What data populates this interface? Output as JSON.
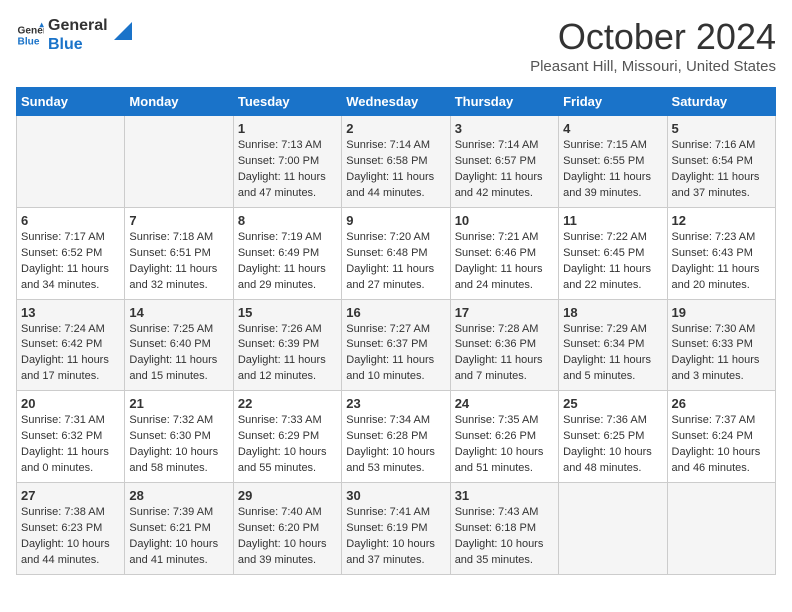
{
  "header": {
    "logo_line1": "General",
    "logo_line2": "Blue",
    "month_title": "October 2024",
    "location": "Pleasant Hill, Missouri, United States"
  },
  "days_of_week": [
    "Sunday",
    "Monday",
    "Tuesday",
    "Wednesday",
    "Thursday",
    "Friday",
    "Saturday"
  ],
  "weeks": [
    [
      {
        "day": "",
        "info": ""
      },
      {
        "day": "",
        "info": ""
      },
      {
        "day": "1",
        "info": "Sunrise: 7:13 AM\nSunset: 7:00 PM\nDaylight: 11 hours and 47 minutes."
      },
      {
        "day": "2",
        "info": "Sunrise: 7:14 AM\nSunset: 6:58 PM\nDaylight: 11 hours and 44 minutes."
      },
      {
        "day": "3",
        "info": "Sunrise: 7:14 AM\nSunset: 6:57 PM\nDaylight: 11 hours and 42 minutes."
      },
      {
        "day": "4",
        "info": "Sunrise: 7:15 AM\nSunset: 6:55 PM\nDaylight: 11 hours and 39 minutes."
      },
      {
        "day": "5",
        "info": "Sunrise: 7:16 AM\nSunset: 6:54 PM\nDaylight: 11 hours and 37 minutes."
      }
    ],
    [
      {
        "day": "6",
        "info": "Sunrise: 7:17 AM\nSunset: 6:52 PM\nDaylight: 11 hours and 34 minutes."
      },
      {
        "day": "7",
        "info": "Sunrise: 7:18 AM\nSunset: 6:51 PM\nDaylight: 11 hours and 32 minutes."
      },
      {
        "day": "8",
        "info": "Sunrise: 7:19 AM\nSunset: 6:49 PM\nDaylight: 11 hours and 29 minutes."
      },
      {
        "day": "9",
        "info": "Sunrise: 7:20 AM\nSunset: 6:48 PM\nDaylight: 11 hours and 27 minutes."
      },
      {
        "day": "10",
        "info": "Sunrise: 7:21 AM\nSunset: 6:46 PM\nDaylight: 11 hours and 24 minutes."
      },
      {
        "day": "11",
        "info": "Sunrise: 7:22 AM\nSunset: 6:45 PM\nDaylight: 11 hours and 22 minutes."
      },
      {
        "day": "12",
        "info": "Sunrise: 7:23 AM\nSunset: 6:43 PM\nDaylight: 11 hours and 20 minutes."
      }
    ],
    [
      {
        "day": "13",
        "info": "Sunrise: 7:24 AM\nSunset: 6:42 PM\nDaylight: 11 hours and 17 minutes."
      },
      {
        "day": "14",
        "info": "Sunrise: 7:25 AM\nSunset: 6:40 PM\nDaylight: 11 hours and 15 minutes."
      },
      {
        "day": "15",
        "info": "Sunrise: 7:26 AM\nSunset: 6:39 PM\nDaylight: 11 hours and 12 minutes."
      },
      {
        "day": "16",
        "info": "Sunrise: 7:27 AM\nSunset: 6:37 PM\nDaylight: 11 hours and 10 minutes."
      },
      {
        "day": "17",
        "info": "Sunrise: 7:28 AM\nSunset: 6:36 PM\nDaylight: 11 hours and 7 minutes."
      },
      {
        "day": "18",
        "info": "Sunrise: 7:29 AM\nSunset: 6:34 PM\nDaylight: 11 hours and 5 minutes."
      },
      {
        "day": "19",
        "info": "Sunrise: 7:30 AM\nSunset: 6:33 PM\nDaylight: 11 hours and 3 minutes."
      }
    ],
    [
      {
        "day": "20",
        "info": "Sunrise: 7:31 AM\nSunset: 6:32 PM\nDaylight: 11 hours and 0 minutes."
      },
      {
        "day": "21",
        "info": "Sunrise: 7:32 AM\nSunset: 6:30 PM\nDaylight: 10 hours and 58 minutes."
      },
      {
        "day": "22",
        "info": "Sunrise: 7:33 AM\nSunset: 6:29 PM\nDaylight: 10 hours and 55 minutes."
      },
      {
        "day": "23",
        "info": "Sunrise: 7:34 AM\nSunset: 6:28 PM\nDaylight: 10 hours and 53 minutes."
      },
      {
        "day": "24",
        "info": "Sunrise: 7:35 AM\nSunset: 6:26 PM\nDaylight: 10 hours and 51 minutes."
      },
      {
        "day": "25",
        "info": "Sunrise: 7:36 AM\nSunset: 6:25 PM\nDaylight: 10 hours and 48 minutes."
      },
      {
        "day": "26",
        "info": "Sunrise: 7:37 AM\nSunset: 6:24 PM\nDaylight: 10 hours and 46 minutes."
      }
    ],
    [
      {
        "day": "27",
        "info": "Sunrise: 7:38 AM\nSunset: 6:23 PM\nDaylight: 10 hours and 44 minutes."
      },
      {
        "day": "28",
        "info": "Sunrise: 7:39 AM\nSunset: 6:21 PM\nDaylight: 10 hours and 41 minutes."
      },
      {
        "day": "29",
        "info": "Sunrise: 7:40 AM\nSunset: 6:20 PM\nDaylight: 10 hours and 39 minutes."
      },
      {
        "day": "30",
        "info": "Sunrise: 7:41 AM\nSunset: 6:19 PM\nDaylight: 10 hours and 37 minutes."
      },
      {
        "day": "31",
        "info": "Sunrise: 7:43 AM\nSunset: 6:18 PM\nDaylight: 10 hours and 35 minutes."
      },
      {
        "day": "",
        "info": ""
      },
      {
        "day": "",
        "info": ""
      }
    ]
  ]
}
